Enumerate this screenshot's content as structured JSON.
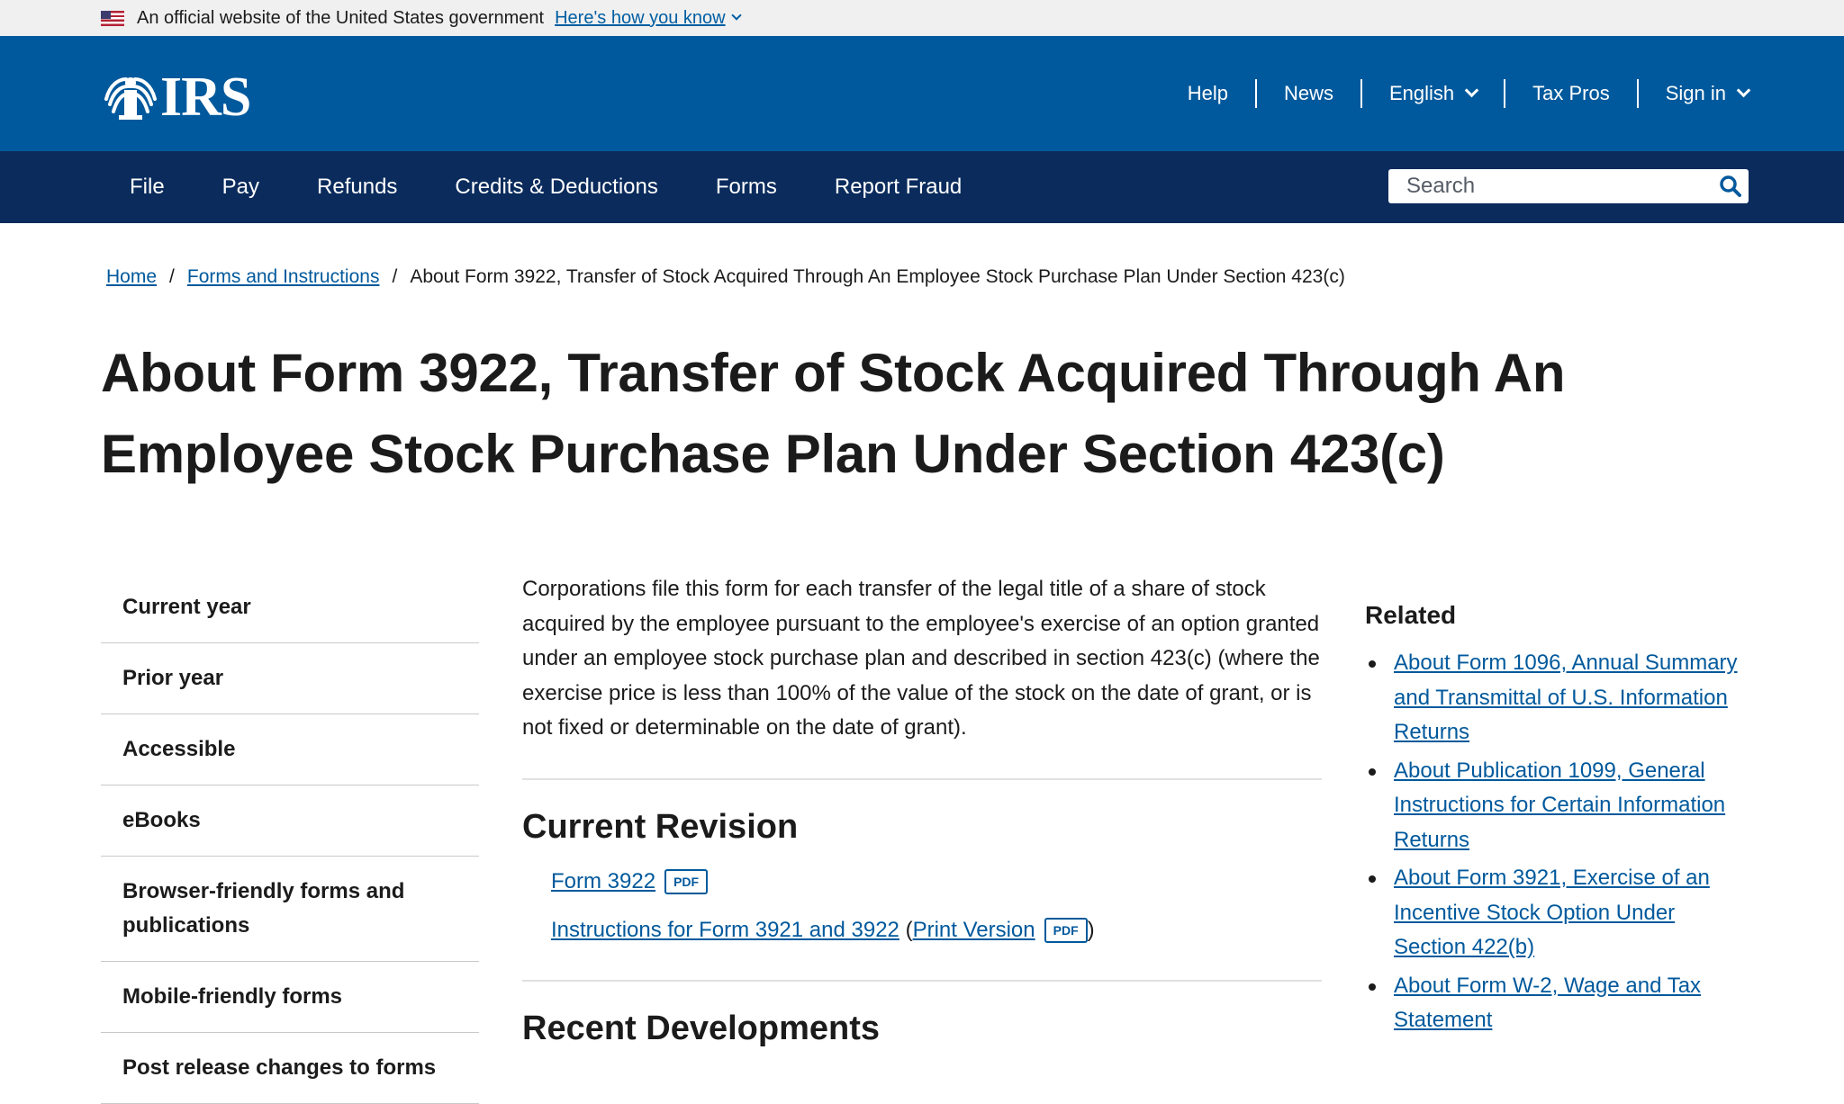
{
  "gov_banner": {
    "text": "An official website of the United States government",
    "link": "Here's how you know"
  },
  "header": {
    "logo_text": "IRS",
    "utility_nav": [
      "Help",
      "News",
      "English",
      "Tax Pros",
      "Sign in"
    ]
  },
  "main_nav": {
    "items": [
      "File",
      "Pay",
      "Refunds",
      "Credits & Deductions",
      "Forms",
      "Report Fraud"
    ],
    "search_placeholder": "Search"
  },
  "breadcrumb": {
    "home": "Home",
    "forms": "Forms and Instructions",
    "current": "About Form 3922, Transfer of Stock Acquired Through An Employee Stock Purchase Plan Under Section 423(c)"
  },
  "page_title": "About Form 3922, Transfer of Stock Acquired Through An Employee Stock Purchase Plan Under Section 423(c)",
  "sidebar": {
    "items": [
      "Current year",
      "Prior year",
      "Accessible",
      "eBooks",
      "Browser-friendly forms and publications",
      "Mobile-friendly forms",
      "Post release changes to forms"
    ]
  },
  "content": {
    "intro": "Corporations file this form for each transfer of the legal title of a share of stock acquired by the employee pursuant to the employee's exercise of an option granted under an employee stock purchase plan and described in section 423(c) (where the exercise price is less than 100% of the value of the stock on the date of grant, or is not fixed or determinable on the date of grant).",
    "current_revision_title": "Current Revision",
    "form_link": "Form 3922",
    "pdf_label": "PDF",
    "instructions_link": "Instructions for Form 3921 and 3922",
    "print_version": "Print Version",
    "open_paren": "(",
    "close_paren": ")",
    "recent_title": "Recent Developments"
  },
  "related": {
    "title": "Related",
    "links": [
      "About Form 1096, Annual Summary and Transmittal of U.S. Information Returns",
      "About Publication 1099, General Instructions for Certain Information Returns",
      "About Form 3921, Exercise of an Incentive Stock Option Under Section 422(b)",
      "About Form W-2, Wage and Tax Statement"
    ]
  },
  "colors": {
    "header_blue": "#00599c",
    "nav_navy": "#0a2b5c",
    "link_blue": "#00599c"
  }
}
